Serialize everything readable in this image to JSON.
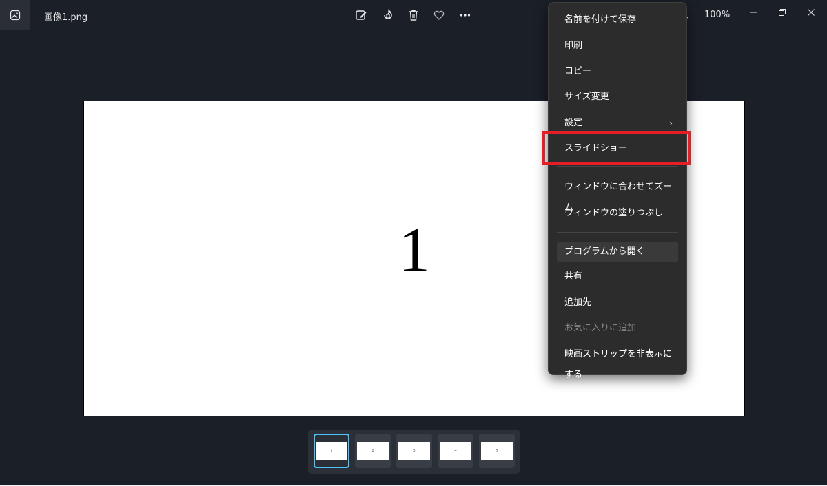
{
  "window": {
    "filename": "画像1.png",
    "zoom_level": "100%"
  },
  "toolbar": {
    "icons": [
      "edit-image-icon",
      "rotate-icon",
      "delete-icon",
      "favorite-icon",
      "more-icon"
    ]
  },
  "canvas": {
    "content": "1"
  },
  "filmstrip": {
    "thumbnails": [
      "1",
      "2",
      "3",
      "4",
      "5"
    ],
    "selected_index": 0
  },
  "context_menu": {
    "items": [
      {
        "label": "名前を付けて保存"
      },
      {
        "label": "印刷"
      },
      {
        "label": "コピー"
      },
      {
        "label": "サイズ変更"
      },
      {
        "label": "設定",
        "has_submenu": true
      },
      {
        "label": "スライドショー",
        "highlighted": true
      },
      {
        "label": "ウィンドウに合わせてズーム"
      },
      {
        "label": "ウィンドウの塗りつぶし"
      },
      {
        "label": "プログラムから開く",
        "hovered": true
      },
      {
        "label": "共有"
      },
      {
        "label": "追加先"
      },
      {
        "label": "お気に入りに追加",
        "disabled": true
      },
      {
        "label": "映画ストリップを非表示にする"
      }
    ]
  },
  "colors": {
    "background": "#1b1f27",
    "menu_background": "#2c2c2c",
    "highlight_box": "#e61e26",
    "selected_thumbnail": "#4cc2ff"
  }
}
